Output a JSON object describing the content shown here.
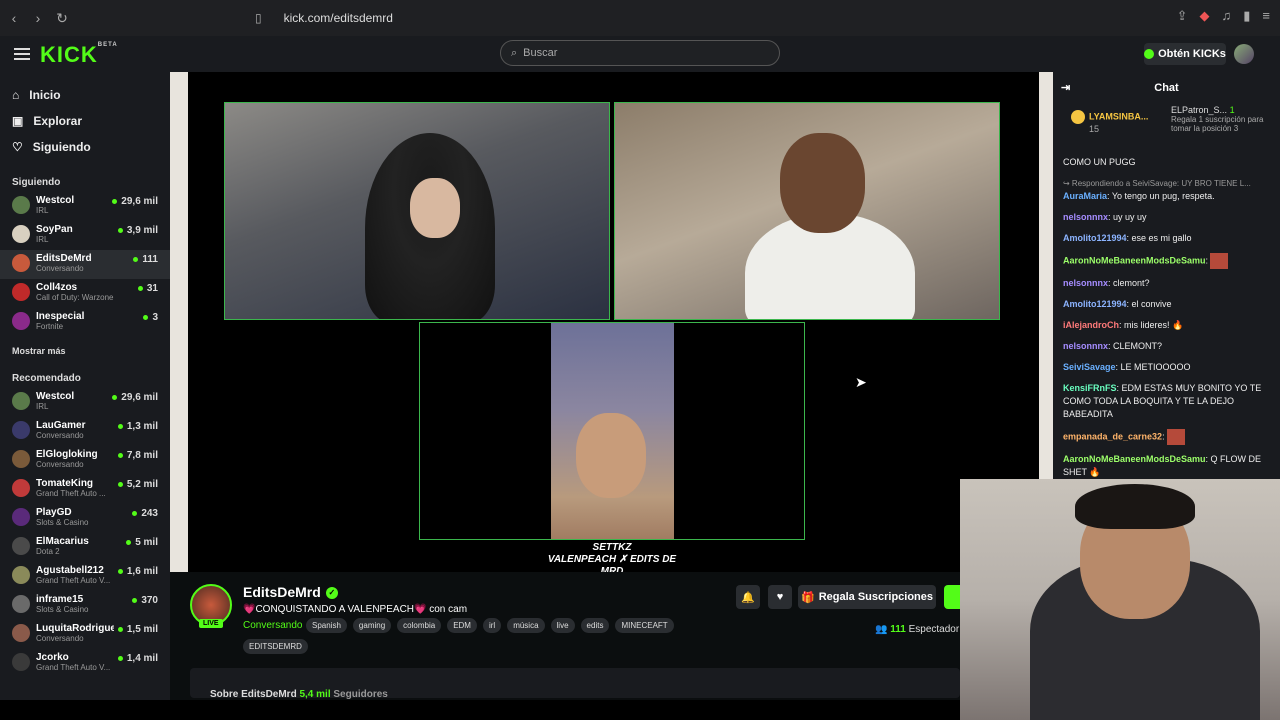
{
  "browser": {
    "url": "kick.com/editsdemrd"
  },
  "header": {
    "logo": "KICK",
    "logo_badge": "BETA",
    "search_placeholder": "Buscar",
    "kicks_label": "Obtén KICKs"
  },
  "sidebar": {
    "nav": [
      {
        "label": "Inicio",
        "icon": "home-icon"
      },
      {
        "label": "Explorar",
        "icon": "compass-icon"
      },
      {
        "label": "Siguiendo",
        "icon": "heart-icon"
      }
    ],
    "following_title": "Siguiendo",
    "following": [
      {
        "name": "Westcol",
        "game": "IRL",
        "viewers": "29,6 mil",
        "color": "#5a7a4a"
      },
      {
        "name": "SoyPan",
        "game": "IRL",
        "viewers": "3,9 mil",
        "color": "#d8d0c0"
      },
      {
        "name": "EditsDeMrd",
        "game": "Conversando",
        "viewers": "111",
        "color": "#c85a3c"
      },
      {
        "name": "Coll4zos",
        "game": "Call of Duty: Warzone",
        "viewers": "31",
        "color": "#c02a2a"
      },
      {
        "name": "Inespecial",
        "game": "Fortnite",
        "viewers": "3",
        "color": "#8a2a8a"
      }
    ],
    "show_more": "Mostrar más",
    "recommended_title": "Recomendado",
    "recommended": [
      {
        "name": "Westcol",
        "game": "IRL",
        "viewers": "29,6 mil",
        "color": "#5a7a4a"
      },
      {
        "name": "LauGamer",
        "game": "Conversando",
        "viewers": "1,3 mil",
        "color": "#3a3a6a"
      },
      {
        "name": "ElGlogloking",
        "game": "Conversando",
        "viewers": "7,8 mil",
        "color": "#7a5a3a"
      },
      {
        "name": "TomateKing",
        "game": "Grand Theft Auto ...",
        "viewers": "5,2 mil",
        "color": "#c03a3a"
      },
      {
        "name": "PlayGD",
        "game": "Slots & Casino",
        "viewers": "243",
        "color": "#5a2a7a"
      },
      {
        "name": "ElMacarius",
        "game": "Dota 2",
        "viewers": "5 mil",
        "color": "#4a4a4a"
      },
      {
        "name": "Agustabell212",
        "game": "Grand Theft Auto V...",
        "viewers": "1,6 mil",
        "color": "#8a8a5a"
      },
      {
        "name": "inframe15",
        "game": "Slots & Casino",
        "viewers": "370",
        "color": "#6a6a6a"
      },
      {
        "name": "LuquitaRodriguez",
        "game": "Conversando",
        "viewers": "1,5 mil",
        "color": "#8a5a4a"
      },
      {
        "name": "Jcorko",
        "game": "Grand Theft Auto V...",
        "viewers": "1,4 mil",
        "color": "#3a3a3a"
      }
    ]
  },
  "video": {
    "caption_line1": "SETTKZ",
    "caption_line2": "VALENPEACH ✗ EDITS DE MRD"
  },
  "channel": {
    "name": "EditsDeMrd",
    "live": "LIVE",
    "title": "💗CONQUISTANDO A VALENPEACH💗 con cam",
    "category": "Conversando",
    "tags": [
      "Spanish",
      "gaming",
      "colombia",
      "EDM",
      "irl",
      "música",
      "live",
      "edits",
      "MINECEAFT"
    ],
    "tag_extra": "EDITSDEMRD",
    "gift_label": "Regala Suscripciones",
    "viewers": "111",
    "viewers_label": "Espectador",
    "about": "Sobre EditsDeMrd",
    "followers": "5,4 mil",
    "followers_label": "Seguidores"
  },
  "chat": {
    "title": "Chat",
    "pinned_user": "LYAMSINBA...",
    "pinned_count": "15",
    "top_user": "ELPatron_S...",
    "top_rank": "1",
    "top_text": "Regala 1 suscripción para tomar la posición 3",
    "messages": [
      {
        "user": "",
        "text": "COMO UN PUGG",
        "color": "#eeeeee"
      },
      {
        "reply": "↪ Respondiendo a SeiviSavage: UY BRO TIENE L...",
        "user": "AuraMaria",
        "text": ": Yo tengo un pug, respeta.",
        "color": "#6ab0ff"
      },
      {
        "user": "nelsonnnx",
        "text": ": uy uy uy",
        "color": "#a58cff"
      },
      {
        "user": "Amolito121994",
        "text": ": ese es mi gallo",
        "color": "#8cb4ff"
      },
      {
        "user": "AaronNoMeBaneenModsDeSamu",
        "text": ":",
        "color": "#9cff6a"
      },
      {
        "user": "nelsonnnx",
        "text": ": clemont?",
        "color": "#a58cff"
      },
      {
        "user": "Amolito121994",
        "text": ": el convive",
        "color": "#8cb4ff"
      },
      {
        "user": "iAlejandroCh",
        "text": ": mis lideres! 🔥",
        "color": "#ff7a7a"
      },
      {
        "user": "nelsonnnx",
        "text": ": CLEMONT?",
        "color": "#a58cff"
      },
      {
        "user": "SeiviSavage",
        "text": ": LE METIOOOOO",
        "color": "#6ab0ff"
      },
      {
        "user": "KensiFRnFS",
        "text": ": EDM ESTAS MUY BONITO YO TE COMO TODA LA BOQUITA Y TE LA DEJO BABEADITA",
        "color": "#6affc0"
      },
      {
        "user": "empanada_de_carne32",
        "text": ":",
        "color": "#ffb46a"
      },
      {
        "user": "AaronNoMeBaneenModsDeSamu",
        "text": ": Q FLOW DE SHET 🔥",
        "color": "#9cff6a"
      }
    ]
  }
}
